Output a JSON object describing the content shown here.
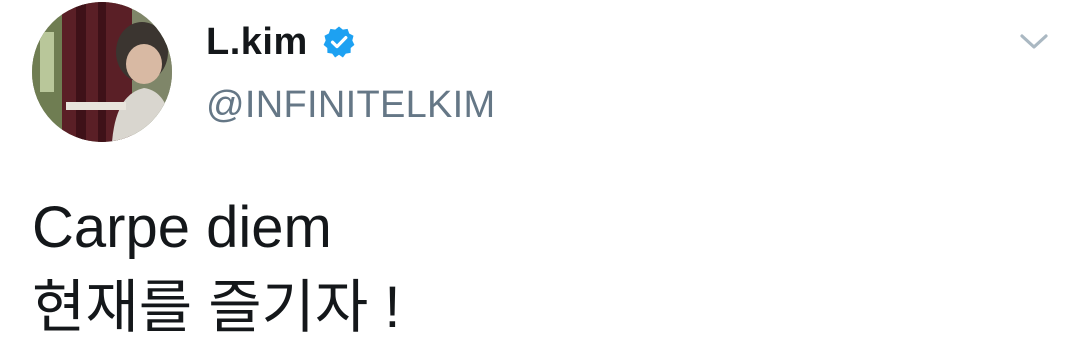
{
  "tweet": {
    "author": {
      "display_name": "L.kim",
      "handle": "@INFINITELKIM",
      "verified": true,
      "avatar_icon": "profile-photo"
    },
    "menu_icon": "chevron-down-icon",
    "text_lines": [
      "Carpe diem",
      "현재를 즐기자 !"
    ]
  },
  "colors": {
    "text_primary": "#14171a",
    "text_secondary": "#657786",
    "verified_blue": "#1da1f2",
    "chevron_gray": "#aab8c2"
  }
}
